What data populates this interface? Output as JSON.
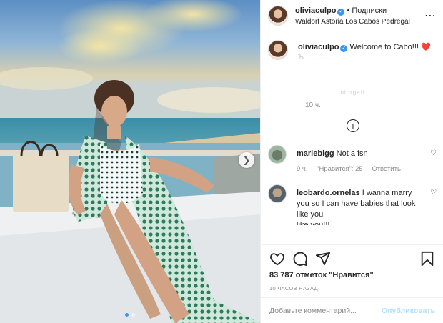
{
  "post": {
    "author": "oliviaculpo",
    "follow_label": "• Подписки",
    "location": "Waldorf Astoria Los Cabos Pedregal",
    "more_icon": "more-horizontal-icon",
    "verified_icon": "verified-badge-icon"
  },
  "caption": {
    "username": "oliviaculpo",
    "text": "Welcome to Cabo!!! ❤️",
    "faded_line": "Ъ ...... ..... .. ..",
    "faded_tag": ".... ......‍olorgati",
    "time": "10 ч."
  },
  "comments": [
    {
      "username": "mariebigg",
      "text": "Not a fsn",
      "time": "9 ч.",
      "likes_label": "\"Нравится\": 25",
      "reply_label": "Ответить"
    },
    {
      "username": "leobardo.ornelas",
      "text": "I wanna marry you so I can have babies that look like you",
      "trailing": "like you!!!"
    }
  ],
  "actions": {
    "like_icon": "heart-icon",
    "comment_icon": "comment-icon",
    "share_icon": "share-icon",
    "save_icon": "bookmark-icon"
  },
  "likes_text": "83 787 отметок \"Нравится\"",
  "posted_ago": "10 ЧАСОВ НАЗАД",
  "comment_box": {
    "placeholder": "Добавьте комментарий...",
    "publish_label": "Опубликовать"
  },
  "carousel": {
    "slides": 2,
    "active": 0
  },
  "colors": {
    "accent": "#3897f0",
    "publish_disabled": "#b2dffc",
    "muted": "#8e8e8e"
  }
}
